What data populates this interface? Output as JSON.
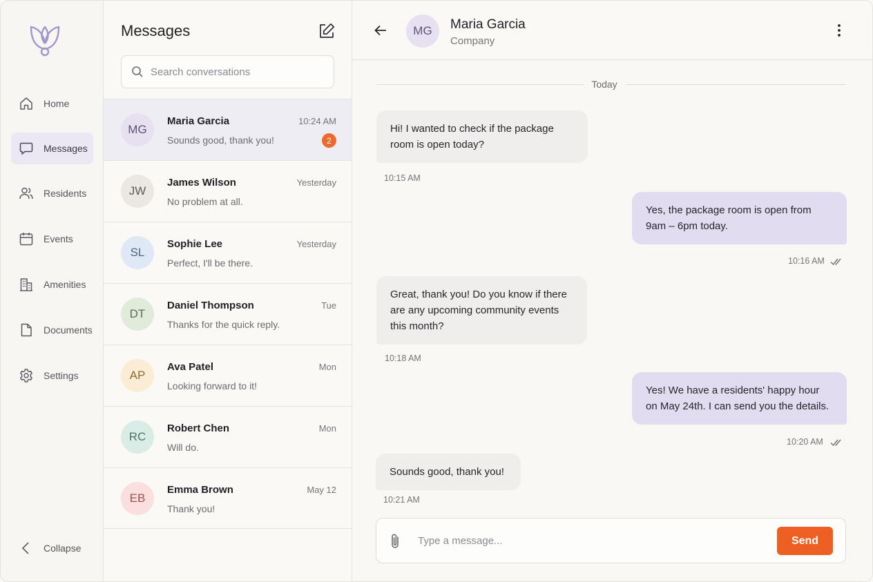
{
  "nav": {
    "items": [
      {
        "label": "Home",
        "icon": "home-icon"
      },
      {
        "label": "Messages",
        "icon": "chat-icon",
        "active": true
      },
      {
        "label": "Residents",
        "icon": "users-icon"
      },
      {
        "label": "Events",
        "icon": "calendar-icon"
      },
      {
        "label": "Amenities",
        "icon": "building-icon"
      },
      {
        "label": "Documents",
        "icon": "document-icon"
      },
      {
        "label": "Settings",
        "icon": "gear-icon"
      }
    ],
    "collapse_label": "Collapse"
  },
  "list": {
    "title": "Messages",
    "search_placeholder": "Search conversations",
    "conversations": [
      {
        "initials": "MG",
        "name": "Maria Garcia",
        "time": "10:24 AM",
        "preview": "Sounds good, thank you!",
        "unread": "2",
        "avatar_bg": "#e6e0f1",
        "avatar_fg": "#5d5478"
      },
      {
        "initials": "JW",
        "name": "James Wilson",
        "time": "Yesterday",
        "preview": "No problem at all.",
        "avatar_bg": "#ebe7e2",
        "avatar_fg": "#5f5a55"
      },
      {
        "initials": "SL",
        "name": "Sophie Lee",
        "time": "Yesterday",
        "preview": "Perfect, I'll be there.",
        "avatar_bg": "#dfe8f5",
        "avatar_fg": "#4e6583"
      },
      {
        "initials": "DT",
        "name": "Daniel Thompson",
        "time": "Tue",
        "preview": "Thanks for the quick reply.",
        "avatar_bg": "#e0ebdc",
        "avatar_fg": "#587050"
      },
      {
        "initials": "AP",
        "name": "Ava Patel",
        "time": "Mon",
        "preview": "Looking forward to it!",
        "avatar_bg": "#fbecd6",
        "avatar_fg": "#8e6a33"
      },
      {
        "initials": "RC",
        "name": "Robert Chen",
        "time": "Mon",
        "preview": "Will do.",
        "avatar_bg": "#d9ece5",
        "avatar_fg": "#4b7668"
      },
      {
        "initials": "EB",
        "name": "Emma Brown",
        "time": "May 12",
        "preview": "Thank you!",
        "avatar_bg": "#fbdede",
        "avatar_fg": "#9a5252"
      }
    ]
  },
  "chat": {
    "contact": {
      "initials": "MG",
      "name": "Maria Garcia",
      "subtitle": "Company"
    },
    "day_label": "Today",
    "messages": [
      {
        "direction": "in",
        "text": "Hi! I wanted to check if the package room is open today?",
        "time": "10:15 AM"
      },
      {
        "direction": "out",
        "text": "Yes, the package room is open from 9am – 6pm today.",
        "time": "10:16 AM",
        "read": true
      },
      {
        "direction": "in",
        "text": "Great, thank you! Do you know if there are any upcoming community events this month?",
        "time": "10:18 AM"
      },
      {
        "direction": "out",
        "text": "Yes! We have a residents' happy hour on May 24th. I can send you the details.",
        "time": "10:20 AM",
        "read": true
      },
      {
        "direction": "in",
        "text": "Sounds good, thank you!",
        "time": "10:21 AM"
      }
    ],
    "composer_placeholder": "Type a message...",
    "send_label": "Send"
  },
  "colors": {
    "accent": "#ed5f22",
    "bubble_out": "#e1dcef",
    "bubble_in": "#efeeec",
    "active_nav": "#ebe8f3"
  }
}
